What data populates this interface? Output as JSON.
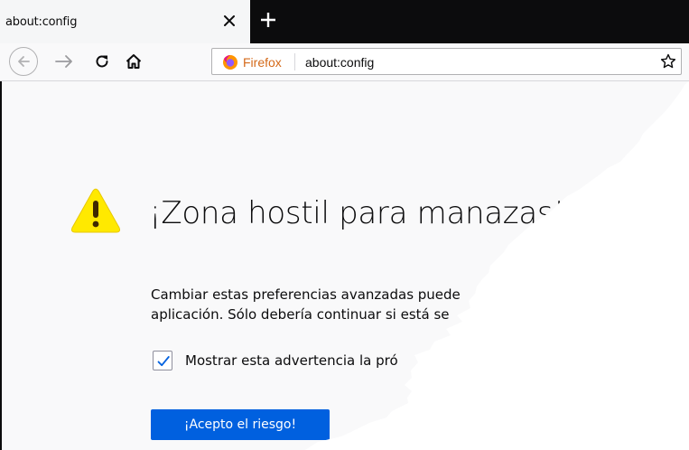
{
  "tab": {
    "title": "about:config",
    "close_icon": "close-icon",
    "new_tab_icon": "plus-icon"
  },
  "navbar": {
    "back_icon": "arrow-left-icon",
    "forward_icon": "arrow-right-icon",
    "reload_icon": "reload-icon",
    "home_icon": "home-icon",
    "identity_label": "Firefox",
    "url": "about:config",
    "bookmark_icon": "star-icon"
  },
  "page": {
    "warning_icon": "warning-triangle-icon",
    "heading": "¡Zona hostil para manazas!",
    "body_line1": "Cambiar estas preferencias avanzadas puede",
    "body_line2": "aplicación. Sólo debería continuar si está se",
    "checkbox_checked": true,
    "checkbox_label": "Mostrar esta advertencia la pró",
    "accept_button": "¡Acepto el riesgo!"
  },
  "colors": {
    "accent": "#0060df",
    "warning": "#ffe900",
    "firefox_label": "#d46a1a"
  }
}
